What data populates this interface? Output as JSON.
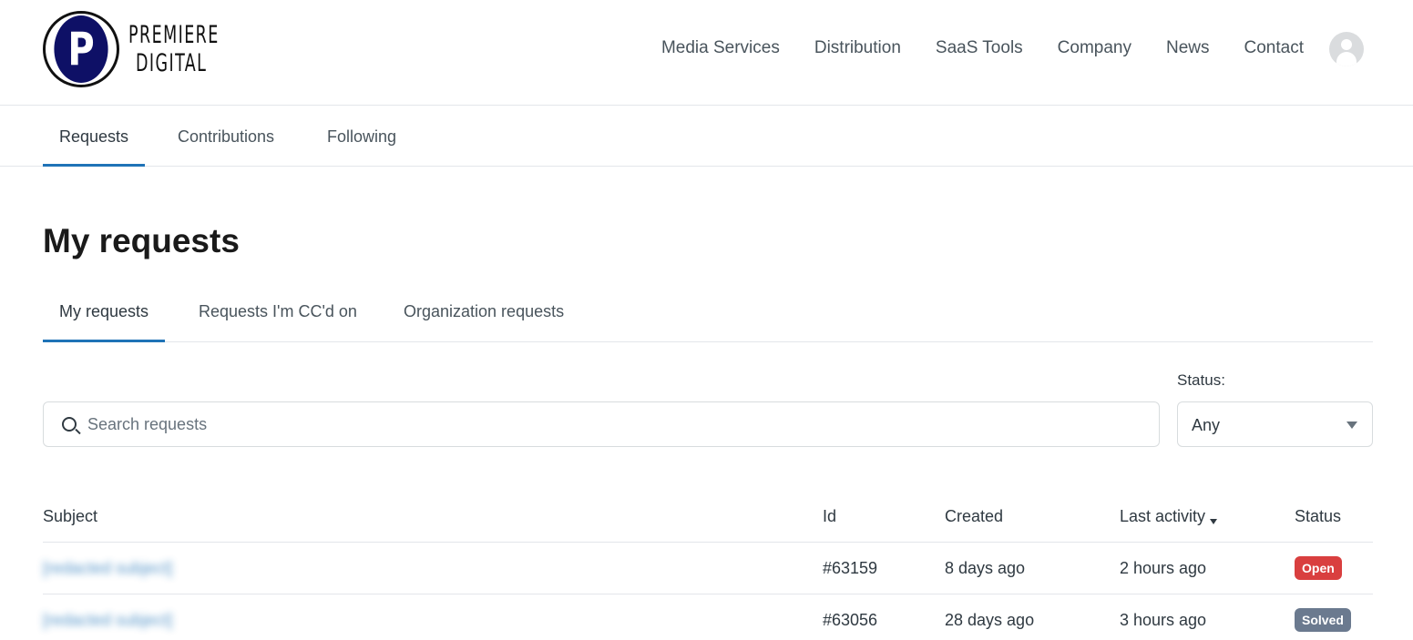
{
  "brand": {
    "logo_letter": "P",
    "line1": "PREMIERE",
    "line2": "DIGITAL"
  },
  "topnav": [
    "Media Services",
    "Distribution",
    "SaaS Tools",
    "Company",
    "News",
    "Contact"
  ],
  "subnav": {
    "requests": "Requests",
    "contributions": "Contributions",
    "following": "Following"
  },
  "page_title": "My requests",
  "request_tabs": {
    "mine": "My requests",
    "cc": "Requests I'm CC'd on",
    "org": "Organization requests"
  },
  "search": {
    "placeholder": "Search requests",
    "value": ""
  },
  "status_filter": {
    "label": "Status:",
    "selected": "Any"
  },
  "table": {
    "headers": {
      "subject": "Subject",
      "id": "Id",
      "created": "Created",
      "last_activity": "Last activity",
      "status": "Status"
    },
    "rows": [
      {
        "subject": "[redacted subject]",
        "id": "#63159",
        "created": "8 days ago",
        "last_activity": "2 hours ago",
        "status": "Open"
      },
      {
        "subject": "[redacted subject]",
        "id": "#63056",
        "created": "28 days ago",
        "last_activity": "3 hours ago",
        "status": "Solved"
      }
    ]
  },
  "colors": {
    "accent": "#1f73b7",
    "open": "#d93f3f",
    "solved": "#6b7a8f",
    "logo": "#0e1066"
  }
}
